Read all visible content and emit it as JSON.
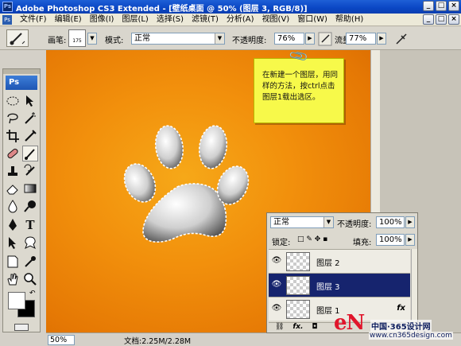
{
  "window": {
    "title": "Adobe Photoshop CS3 Extended - [壁纸桌面 @ 50% (图层 3, RGB/8)]",
    "app_badge": "Ps",
    "controls": [
      "_",
      "□",
      "×"
    ]
  },
  "menu": [
    "文件(F)",
    "编辑(E)",
    "图像(I)",
    "图层(L)",
    "选择(S)",
    "滤镜(T)",
    "分析(A)",
    "视图(V)",
    "窗口(W)",
    "帮助(H)"
  ],
  "doc_controls": [
    "_",
    "□",
    "×"
  ],
  "options": {
    "brush_label": "画笔:",
    "brush_size": "175",
    "mode_label": "模式:",
    "mode_value": "正常",
    "opacity_label": "不透明度:",
    "opacity_value": "76%",
    "flow_label": "流量:",
    "flow_value": "77%"
  },
  "toolbox": {
    "logo": "Ps",
    "tools": [
      "marquee-icon",
      "move-icon",
      "lasso-icon",
      "magic-wand-icon",
      "crop-icon",
      "slice-icon",
      "healing-icon",
      "brush-icon",
      "stamp-icon",
      "history-brush-icon",
      "eraser-icon",
      "gradient-icon",
      "blur-icon",
      "dodge-icon",
      "pen-icon",
      "type-icon",
      "path-select-icon",
      "shape-icon",
      "notes-icon",
      "eyedropper-icon",
      "hand-icon",
      "zoom-icon"
    ],
    "type_glyph": "T",
    "fg_color": "#ffffff",
    "bg_color": "#000000"
  },
  "note": {
    "text": "在新建一个图层，用同样的方法，按ctrl点击图层1载出选区。"
  },
  "status": {
    "zoom": "50%",
    "doc": "文档:2.25M/2.28M"
  },
  "layers": {
    "blend": "正常",
    "opacity_label": "不透明度:",
    "opacity": "100%",
    "lock_label": "锁定:",
    "fill_label": "填充:",
    "fill": "100%",
    "rows": [
      {
        "name": "图层 2",
        "selected": false,
        "fx": ""
      },
      {
        "name": "图层 3",
        "selected": true,
        "fx": ""
      },
      {
        "name": "图层 1",
        "selected": false,
        "fx": "fx"
      }
    ],
    "bottom_fx": "fx."
  },
  "colors": {
    "canvas_center": "#f6a818",
    "canvas_edge": "#d86a00",
    "note_bg": "#f7f94a",
    "selected_layer": "#16246e"
  },
  "watermark": {
    "logo": "eN",
    "cn_text": "中国·365设计网",
    "url": "www.cn365design.com"
  }
}
